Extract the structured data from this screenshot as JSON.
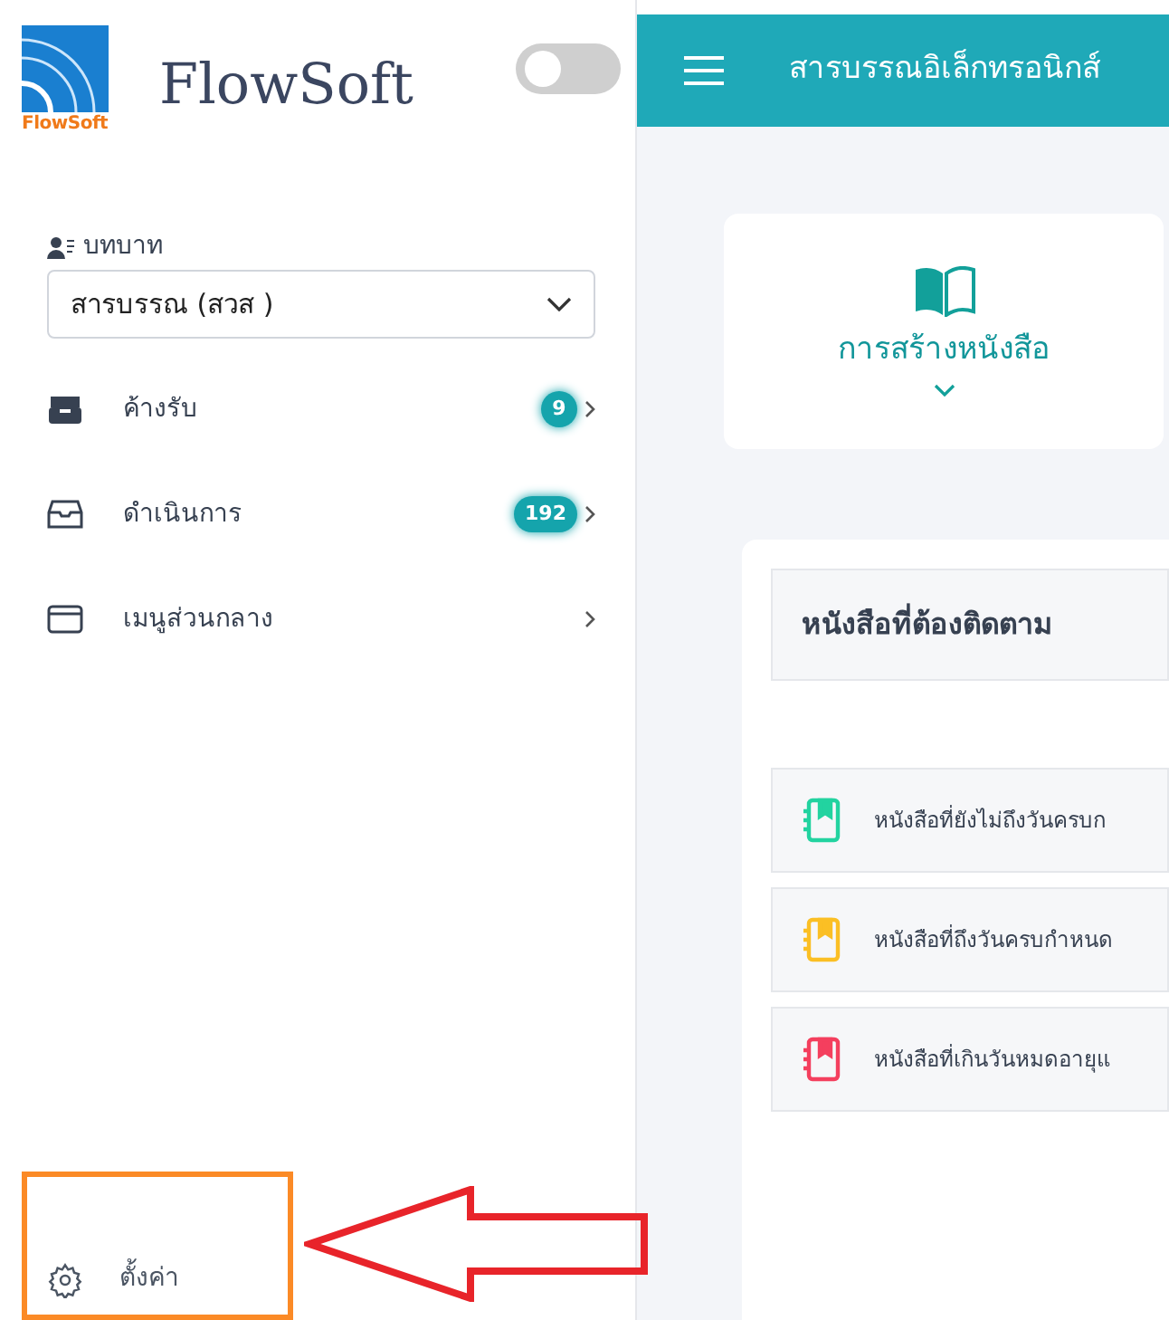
{
  "sidebar": {
    "brand": "FlowSoft",
    "logo_caption": "FlowSoft",
    "dark_mode": {
      "on": false
    },
    "role": {
      "label": "บทบาท",
      "value": "สารบรรณ (สวส )"
    },
    "items": [
      {
        "kind": "inbox",
        "label": "ค้างรับ",
        "badge": "9"
      },
      {
        "kind": "outbox",
        "label": "ดำเนินการ",
        "badge": "192"
      },
      {
        "kind": "window",
        "label": "เมนูส่วนกลาง"
      }
    ],
    "settings": {
      "label": "ตั้งค่า"
    }
  },
  "header": {
    "title": "สารบรรณอิเล็กทรอนิกส์"
  },
  "create_card": {
    "label": "การสร้างหนังสือ"
  },
  "tracking": {
    "title": "หนังสือที่ต้องติดตาม",
    "rows": [
      {
        "label": "หนังสือที่ยังไม่ถึงวันครบก",
        "color": "#22d3a0"
      },
      {
        "label": "หนังสือที่ถึงวันครบกำหนด",
        "color": "#fbbf24"
      },
      {
        "label": "หนังสือที่เกินวันหมดอายุแ",
        "color": "#f43f5e"
      }
    ]
  },
  "annotation": {
    "highlight": true,
    "arrow": true
  }
}
